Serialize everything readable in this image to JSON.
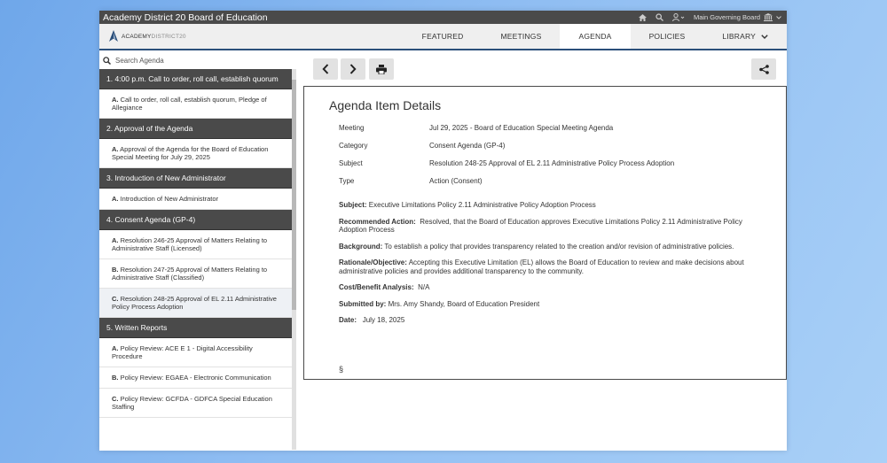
{
  "window": {
    "title": "Academy District 20 Board of Education",
    "governing_board": "Main Governing Board"
  },
  "logo": {
    "text_bold": "ACADEMY",
    "text_light": "DISTRICT20"
  },
  "nav": {
    "tabs": [
      {
        "label": "FEATURED"
      },
      {
        "label": "MEETINGS"
      },
      {
        "label": "AGENDA"
      },
      {
        "label": "POLICIES"
      },
      {
        "label": "LIBRARY"
      }
    ]
  },
  "sidebar": {
    "search_placeholder": "Search Agenda",
    "sections": [
      {
        "title": "1. 4:00 p.m. Call to order, roll call, establish quorum",
        "items": [
          {
            "letter": "A.",
            "text": "Call to order, roll call, establish quorum, Pledge of Allegiance"
          }
        ]
      },
      {
        "title": "2. Approval of the Agenda",
        "items": [
          {
            "letter": "A.",
            "text": "Approval of the Agenda for the Board of Education Special Meeting for July 29, 2025"
          }
        ]
      },
      {
        "title": "3. Introduction of New Administrator",
        "items": [
          {
            "letter": "A.",
            "text": "Introduction of New Administrator"
          }
        ]
      },
      {
        "title": "4. Consent Agenda (GP-4)",
        "items": [
          {
            "letter": "A.",
            "text": "Resolution 246-25 Approval of Matters Relating to Administrative Staff (Licensed)"
          },
          {
            "letter": "B.",
            "text": "Resolution 247-25 Approval of Matters Relating to Administrative Staff (Classified)"
          },
          {
            "letter": "C.",
            "text": "Resolution 248-25 Approval of EL 2.11 Administrative Policy Process Adoption"
          }
        ]
      },
      {
        "title": "5. Written Reports",
        "items": [
          {
            "letter": "A.",
            "text": "Policy Review: ACE E 1 - Digital Accessibility Procedure"
          },
          {
            "letter": "B.",
            "text": "Policy Review: EGAEA - Electronic Communication"
          },
          {
            "letter": "C.",
            "text": "Policy Review: GCFDA - GDFCA Special Education Staffing"
          }
        ]
      }
    ]
  },
  "details": {
    "heading": "Agenda Item Details",
    "meta": [
      {
        "key": "Meeting",
        "value": "Jul 29, 2025 - Board of Education Special Meeting Agenda"
      },
      {
        "key": "Category",
        "value": "Consent Agenda (GP-4)"
      },
      {
        "key": "Subject",
        "value": "Resolution 248-25 Approval of EL 2.11 Administrative Policy Process Adoption"
      },
      {
        "key": "Type",
        "value": "Action (Consent)"
      }
    ],
    "paragraphs": [
      {
        "label": "Subject:",
        "text": "Executive Limitations Policy 2.11 Administrative Policy Adoption Process"
      },
      {
        "label": "Recommended Action:",
        "text": "Resolved, that the Board of Education approves Executive Limitations Policy 2.11 Administrative Policy Adoption Process"
      },
      {
        "label": "Background:",
        "text": "To establish a policy that provides transparency related to the creation and/or revision of administrative policies."
      },
      {
        "label": "Rationale/Objective:",
        "text": "Accepting this Executive Limitation (EL) allows the Board of Education to review and make decisions about administrative policies and provides additional transparency to the community."
      },
      {
        "label": "Cost/Benefit Analysis:",
        "text": "N/A"
      },
      {
        "label": "Submitted by:",
        "text": "Mrs. Amy Shandy, Board of Education President"
      },
      {
        "label": "Date:",
        "text": "July 18, 2025"
      }
    ],
    "section_mark": "§"
  }
}
